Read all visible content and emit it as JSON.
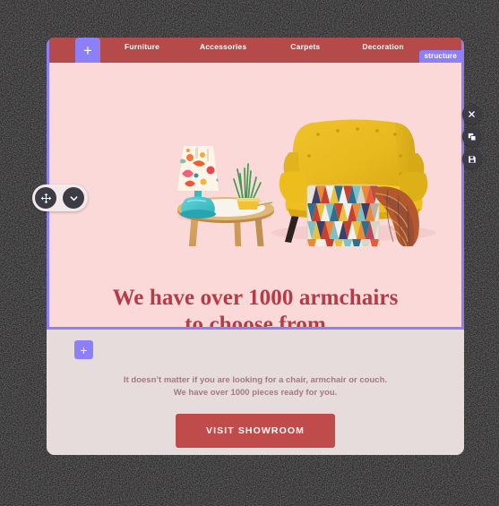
{
  "editor": {
    "section_badge": "structure",
    "add_block_label": "+",
    "left_tools": [
      {
        "name": "move-handle",
        "icon": "move-icon"
      },
      {
        "name": "collapse-toggle",
        "icon": "chevron-down-icon"
      }
    ],
    "right_tools": [
      {
        "name": "close-button",
        "icon": "close-icon"
      },
      {
        "name": "duplicate-button",
        "icon": "duplicate-icon"
      },
      {
        "name": "save-button",
        "icon": "save-icon"
      }
    ]
  },
  "nav": {
    "items": [
      {
        "label": "Furniture"
      },
      {
        "label": "Accessories"
      },
      {
        "label": "Carpets"
      },
      {
        "label": "Decoration"
      }
    ]
  },
  "hero": {
    "headline_line1": "We have over 1000 armchairs",
    "headline_line2": "to choose from",
    "background": "#fbd9d9",
    "headline_color": "#b63b46",
    "scene": {
      "lamp": "table-lamp",
      "plant": "potted-plant",
      "table": "side-table",
      "armchair": "yellow-armchair",
      "pillow": "geometric-pillow",
      "throw": "plaid-throw"
    }
  },
  "promo": {
    "line1": "It doesn’t matter if you are looking for a chair, armchair or couch.",
    "line2": "We have over 1000 pieces ready for you.",
    "cta_label": "VISIT SHOWROOM",
    "cta_color": "#c04b4b",
    "background": "#e7dcdc"
  },
  "colors": {
    "navbar": "#b44a4a",
    "accent_purple": "#8d80f7",
    "tool_dark": "#3c3c44"
  }
}
